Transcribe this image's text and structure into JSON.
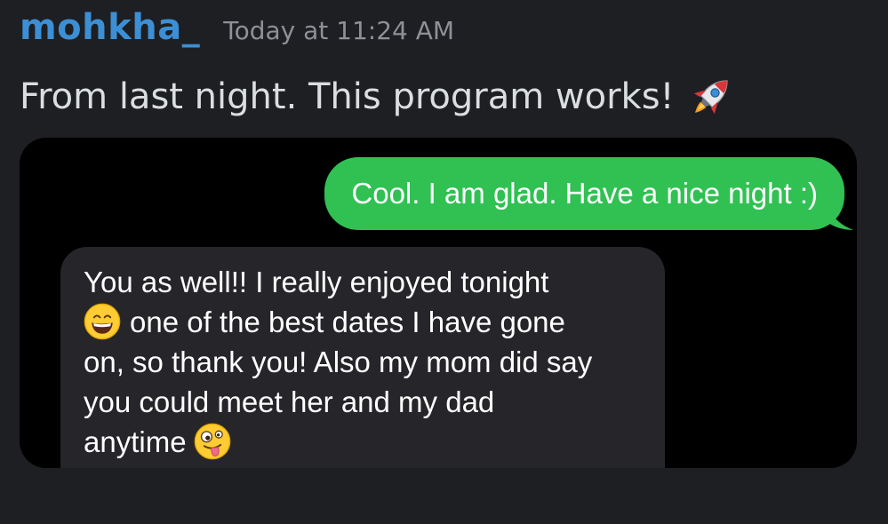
{
  "post": {
    "username": "mohkha_",
    "timestamp": "Today at 11:24 AM",
    "message": "From last night. This program works!",
    "message_emoji": "rocket-icon"
  },
  "attachment": {
    "sent": {
      "text": "Cool. I am glad. Have a nice night :)"
    },
    "received": {
      "lines": [
        "You as well!! I really enjoyed tonight",
        "one of the best dates I have gone",
        "on, so thank you! Also my mom did say",
        "you could meet her and my dad",
        "anytime"
      ],
      "emojis": [
        "grinning-face-icon",
        "zany-face-icon"
      ]
    },
    "colors": {
      "sent_bubble": "#30c152",
      "received_bubble": "#26262a",
      "background": "#000000"
    }
  },
  "colors": {
    "username": "#3c8fd4",
    "timestamp": "#8d9096",
    "message": "#dbdee1",
    "background": "#1e1f22"
  }
}
